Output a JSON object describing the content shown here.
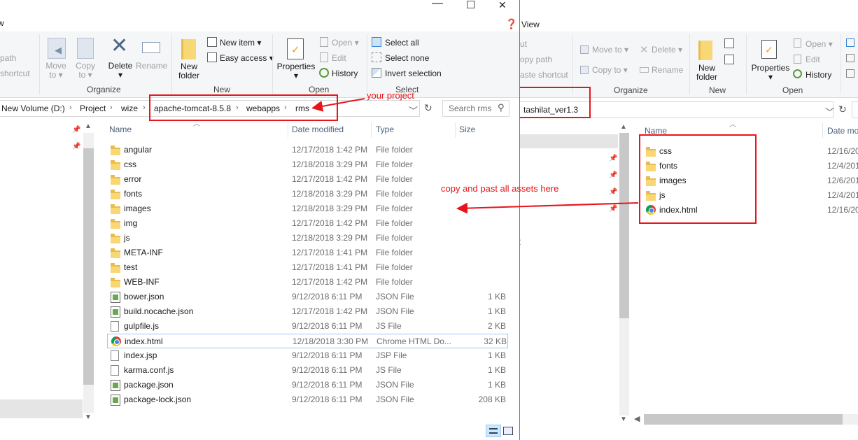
{
  "left_window": {
    "title_bar": {
      "minimize": "—",
      "maximize": "☐",
      "close": "✕"
    },
    "ribbon_tab": "w",
    "ribbon": {
      "clipboard": {
        "copy_path": "path",
        "paste_shortcut": "shortcut"
      },
      "organize": {
        "label": "Organize",
        "move_to": [
          "Move",
          "to ▾"
        ],
        "copy_to": [
          "Copy",
          "to ▾"
        ],
        "delete": [
          "Delete",
          "▾"
        ],
        "rename": "Rename"
      },
      "new": {
        "label": "New",
        "new_folder": [
          "New",
          "folder"
        ],
        "new_item": "New item ▾",
        "easy_access": "Easy access ▾"
      },
      "open": {
        "label": "Open",
        "properties": [
          "Properties",
          "▾"
        ],
        "open": "Open ▾",
        "edit": "Edit",
        "history": "History"
      },
      "select": {
        "label": "Select",
        "select_all": "Select all",
        "select_none": "Select none",
        "invert": "Invert selection"
      }
    },
    "address": {
      "crumbs": [
        "New Volume (D:)",
        "Project",
        "wize",
        "apache-tomcat-8.5.8",
        "webapps",
        "rms"
      ],
      "search_placeholder": "Search rms"
    },
    "columns": {
      "name": "Name",
      "date": "Date modified",
      "type": "Type",
      "size": "Size"
    },
    "files": [
      {
        "name": "angular",
        "date": "12/17/2018 1:42 PM",
        "type": "File folder",
        "size": "",
        "icon": "folder-icon"
      },
      {
        "name": "css",
        "date": "12/18/2018 3:29 PM",
        "type": "File folder",
        "size": "",
        "icon": "folder-icon"
      },
      {
        "name": "error",
        "date": "12/17/2018 1:42 PM",
        "type": "File folder",
        "size": "",
        "icon": "folder-icon"
      },
      {
        "name": "fonts",
        "date": "12/18/2018 3:29 PM",
        "type": "File folder",
        "size": "",
        "icon": "folder-icon"
      },
      {
        "name": "images",
        "date": "12/18/2018 3:29 PM",
        "type": "File folder",
        "size": "",
        "icon": "folder-icon"
      },
      {
        "name": "img",
        "date": "12/17/2018 1:42 PM",
        "type": "File folder",
        "size": "",
        "icon": "folder-icon"
      },
      {
        "name": "js",
        "date": "12/18/2018 3:29 PM",
        "type": "File folder",
        "size": "",
        "icon": "folder-icon"
      },
      {
        "name": "META-INF",
        "date": "12/17/2018 1:41 PM",
        "type": "File folder",
        "size": "",
        "icon": "folder-icon"
      },
      {
        "name": "test",
        "date": "12/17/2018 1:41 PM",
        "type": "File folder",
        "size": "",
        "icon": "folder-icon"
      },
      {
        "name": "WEB-INF",
        "date": "12/17/2018 1:42 PM",
        "type": "File folder",
        "size": "",
        "icon": "folder-icon"
      },
      {
        "name": "bower.json",
        "date": "9/12/2018 6:11 PM",
        "type": "JSON File",
        "size": "1 KB",
        "icon": "json-file-icon"
      },
      {
        "name": "build.nocache.json",
        "date": "12/17/2018 1:42 PM",
        "type": "JSON File",
        "size": "1 KB",
        "icon": "json-file-icon"
      },
      {
        "name": "gulpfile.js",
        "date": "9/12/2018 6:11 PM",
        "type": "JS File",
        "size": "2 KB",
        "icon": "js-file-icon"
      },
      {
        "name": "index.html",
        "date": "12/18/2018 3:30 PM",
        "type": "Chrome HTML Do...",
        "size": "32 KB",
        "icon": "chrome-html-icon"
      },
      {
        "name": "index.jsp",
        "date": "9/12/2018 6:11 PM",
        "type": "JSP File",
        "size": "1 KB",
        "icon": "jsp-file-icon"
      },
      {
        "name": "karma.conf.js",
        "date": "9/12/2018 6:11 PM",
        "type": "JS File",
        "size": "1 KB",
        "icon": "js-file-icon"
      },
      {
        "name": "package.json",
        "date": "9/12/2018 6:11 PM",
        "type": "JSON File",
        "size": "1 KB",
        "icon": "json-file-icon"
      },
      {
        "name": "package-lock.json",
        "date": "9/12/2018 6:11 PM",
        "type": "JSON File",
        "size": "208 KB",
        "icon": "json-file-icon"
      }
    ],
    "annotation": "your project"
  },
  "right_window": {
    "ribbon_tab": "View",
    "ribbon": {
      "clipboard": {
        "cut": "ut",
        "copy_path": "opy path",
        "paste_shortcut": "aste shortcut"
      },
      "organize": {
        "label": "Organize",
        "move_to": "Move to ▾",
        "copy_to": "Copy to ▾",
        "delete": "Delete ▾",
        "rename": "Rename"
      },
      "new": {
        "label": "New",
        "new_folder": [
          "New",
          "folder"
        ]
      },
      "open": {
        "label": "Open",
        "properties": [
          "Properties",
          "▾"
        ],
        "open": "Open ▾",
        "edit": "Edit",
        "history": "History"
      }
    },
    "address": {
      "path": "tashilat_ver1.3"
    },
    "columns": {
      "name": "Name",
      "date": "Date mo"
    },
    "files": [
      {
        "name": "css",
        "date": "12/16/20",
        "icon": "folder-icon"
      },
      {
        "name": "fonts",
        "date": "12/4/201",
        "icon": "folder-icon"
      },
      {
        "name": "images",
        "date": "12/6/201",
        "icon": "folder-icon"
      },
      {
        "name": "js",
        "date": "12/4/201",
        "icon": "folder-icon"
      },
      {
        "name": "index.html",
        "date": "12/16/20",
        "icon": "chrome-html-icon"
      }
    ],
    "nav_fragment": "2",
    "annotation": "copy and past all assets here"
  },
  "colors": {
    "accent": "#3a85d8",
    "annotation_red": "#e8141b",
    "selection_border": "#99c9ef",
    "folder": "#f8d775"
  }
}
